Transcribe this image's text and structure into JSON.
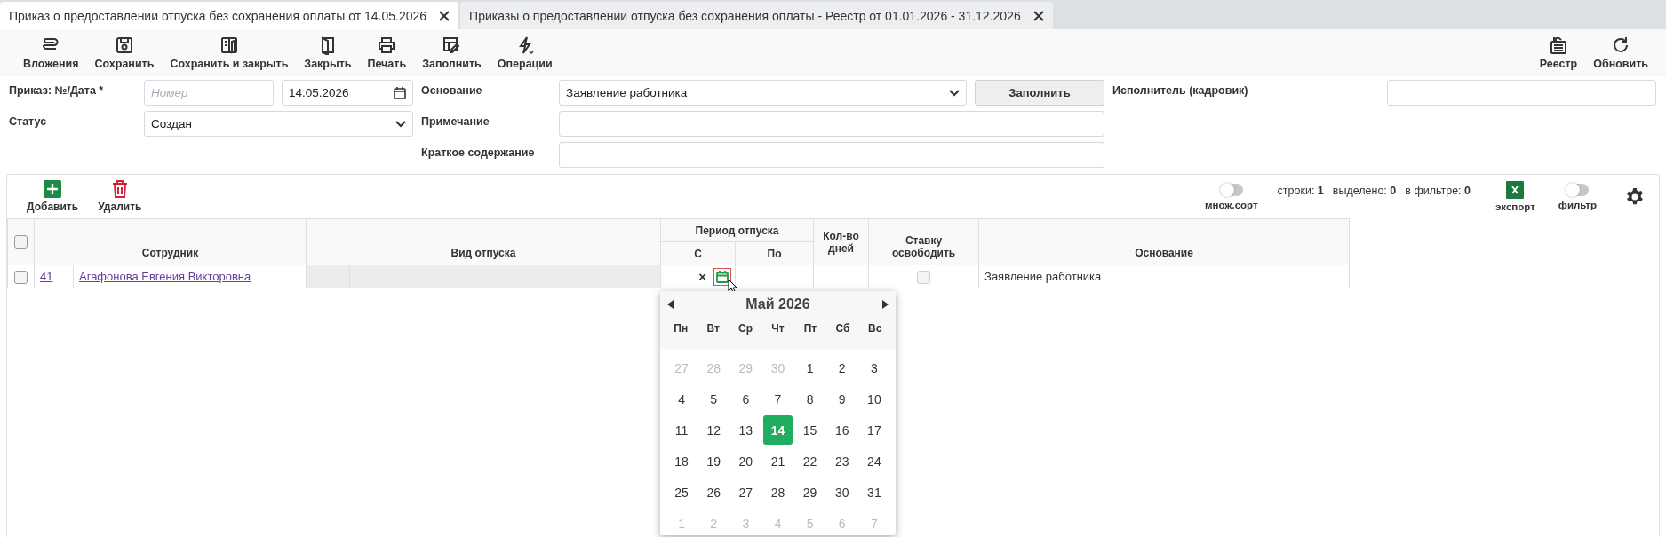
{
  "tabs": [
    {
      "title": "Приказ о предоставлении отпуска без сохранения оплаты от 14.05.2026",
      "selected": true
    },
    {
      "title": "Приказы о предоставлении отпуска без сохранения оплаты - Реестр от 01.01.2026 - 31.12.2026",
      "selected": false
    }
  ],
  "toolbar": {
    "left": [
      "Вложения",
      "Сохранить",
      "Сохранить и закрыть",
      "Закрыть",
      "Печать",
      "Заполнить",
      "Операции"
    ],
    "right": [
      "Реестр",
      "Обновить"
    ]
  },
  "form": {
    "order_label": "Приказ: №/Дата *",
    "number": {
      "placeholder": "Номер"
    },
    "date": {
      "value": "14.05.2026"
    },
    "status_label": "Статус",
    "status": {
      "value": "Создан"
    },
    "basis_label": "Основание",
    "basis": {
      "value": "Заявление работника"
    },
    "fill_button": "Заполнить",
    "note_label": "Примечание",
    "summary_label": "Краткое содержание",
    "executor_label": "Исполнитель (кадровик)"
  },
  "grid": {
    "add": "Добавить",
    "delete": "Удалить",
    "multisort": {
      "label": "множ.сорт",
      "on": false
    },
    "stats": [
      {
        "label": "строки:",
        "value": "1"
      },
      {
        "label": "выделено:",
        "value": "0"
      },
      {
        "label": "в фильтре:",
        "value": "0"
      }
    ],
    "export": "экспорт",
    "filter": {
      "label": "фильтр",
      "on": false
    },
    "all_checked": false,
    "columns": {
      "employee": "Сотрудник",
      "leave_type": "Вид отпуска",
      "period": "Период отпуска",
      "from": "С",
      "to": "По",
      "days": "Кол-во дней",
      "release": "Ставку освободить",
      "basis": "Основание"
    },
    "rows": [
      {
        "checked": false,
        "number": "41",
        "employee": "Агафонова Евгения Викторовна",
        "clear": "×",
        "release": false,
        "basis": "Заявление работника"
      }
    ]
  },
  "calendar": {
    "month": "Май 2026",
    "weekdays": [
      "Пн",
      "Вт",
      "Ср",
      "Чт",
      "Пт",
      "Сб",
      "Вс"
    ],
    "weeks": [
      [
        {
          "day": "27",
          "outside": true,
          "selected": false
        },
        {
          "day": "28",
          "outside": true,
          "selected": false
        },
        {
          "day": "29",
          "outside": true,
          "selected": false
        },
        {
          "day": "30",
          "outside": true,
          "selected": false
        },
        {
          "day": "1",
          "outside": false,
          "selected": false
        },
        {
          "day": "2",
          "outside": false,
          "selected": false
        },
        {
          "day": "3",
          "outside": false,
          "selected": false
        }
      ],
      [
        {
          "day": "4",
          "outside": false,
          "selected": false
        },
        {
          "day": "5",
          "outside": false,
          "selected": false
        },
        {
          "day": "6",
          "outside": false,
          "selected": false
        },
        {
          "day": "7",
          "outside": false,
          "selected": false
        },
        {
          "day": "8",
          "outside": false,
          "selected": false
        },
        {
          "day": "9",
          "outside": false,
          "selected": false
        },
        {
          "day": "10",
          "outside": false,
          "selected": false
        }
      ],
      [
        {
          "day": "11",
          "outside": false,
          "selected": false
        },
        {
          "day": "12",
          "outside": false,
          "selected": false
        },
        {
          "day": "13",
          "outside": false,
          "selected": false
        },
        {
          "day": "14",
          "outside": false,
          "selected": true
        },
        {
          "day": "15",
          "outside": false,
          "selected": false
        },
        {
          "day": "16",
          "outside": false,
          "selected": false
        },
        {
          "day": "17",
          "outside": false,
          "selected": false
        }
      ],
      [
        {
          "day": "18",
          "outside": false,
          "selected": false
        },
        {
          "day": "19",
          "outside": false,
          "selected": false
        },
        {
          "day": "20",
          "outside": false,
          "selected": false
        },
        {
          "day": "21",
          "outside": false,
          "selected": false
        },
        {
          "day": "22",
          "outside": false,
          "selected": false
        },
        {
          "day": "23",
          "outside": false,
          "selected": false
        },
        {
          "day": "24",
          "outside": false,
          "selected": false
        }
      ],
      [
        {
          "day": "25",
          "outside": false,
          "selected": false
        },
        {
          "day": "26",
          "outside": false,
          "selected": false
        },
        {
          "day": "27",
          "outside": false,
          "selected": false
        },
        {
          "day": "28",
          "outside": false,
          "selected": false
        },
        {
          "day": "29",
          "outside": false,
          "selected": false
        },
        {
          "day": "30",
          "outside": false,
          "selected": false
        },
        {
          "day": "31",
          "outside": false,
          "selected": false
        }
      ],
      [
        {
          "day": "1",
          "outside": true,
          "selected": false
        },
        {
          "day": "2",
          "outside": true,
          "selected": false
        },
        {
          "day": "3",
          "outside": true,
          "selected": false
        },
        {
          "day": "4",
          "outside": true,
          "selected": false
        },
        {
          "day": "5",
          "outside": true,
          "selected": false
        },
        {
          "day": "6",
          "outside": true,
          "selected": false
        },
        {
          "day": "7",
          "outside": true,
          "selected": false
        }
      ]
    ]
  }
}
